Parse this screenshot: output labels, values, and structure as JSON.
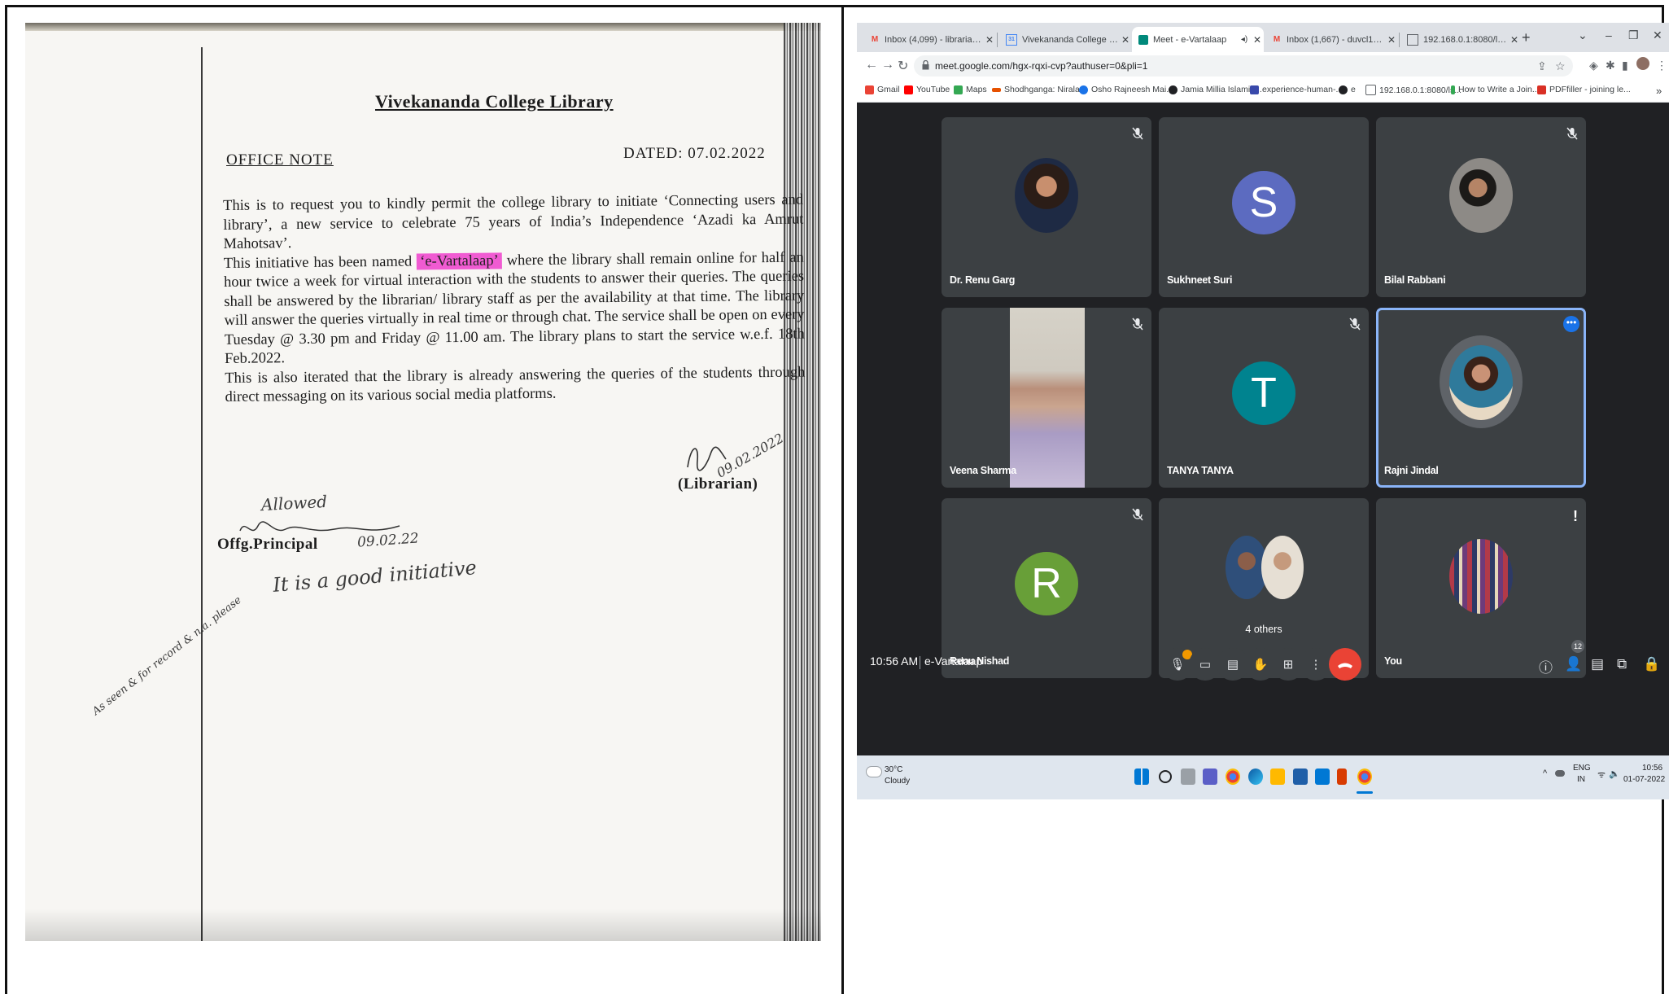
{
  "note": {
    "title": "Vivekananda College Library",
    "heading": "OFFICE NOTE",
    "dated": "DATED: 07.02.2022",
    "para1": "This is to request you to kindly permit the college library to initiate ‘Connecting users and library’, a new service to celebrate 75 years of India’s Independence ‘Azadi ka Amrut Mahotsav’.",
    "para2_before": "This initiative has been named",
    "para2_highlight": "‘e-Vartalaap’",
    "para2_after": "where the library shall remain online for half an hour twice a week for virtual interaction with the students to answer their queries. The queries shall be answered by the librarian/ library staff as per the availability at that time. The library will answer the queries virtually in real time or through chat. The service shall be open on every Tuesday @ 3.30 pm and Friday @ 11.00 am. The library plans to start the service w.e.f. 18th Feb.2022.",
    "para3": "This is also iterated that the library is already answering the queries of the students through direct messaging on its various social media platforms.",
    "librarian": "(Librarian)",
    "librarian_sign_date": "09.02.2022",
    "principal": "Offg.Principal",
    "principal_handwritten_allowed": "Allowed",
    "principal_date": "09.02.22",
    "principal_remark": "It is a good initiative",
    "margin_note": "As seen & for record & n.a. please"
  },
  "browser": {
    "tabs": [
      {
        "title": "Inbox (4,099) - librarian@viveka",
        "icon": "gmail-icon",
        "color": "#ea4335"
      },
      {
        "title": "Vivekananda College - Calendar",
        "icon": "calendar-icon",
        "color": "#4285f4"
      },
      {
        "title": "Meet - e-Vartalaap",
        "icon": "meet-icon",
        "color": "#00897b"
      },
      {
        "title": "Inbox (1,667) - duvcl13@gmail",
        "icon": "gmail-icon",
        "color": "#ea4335"
      },
      {
        "title": "192.168.0.1:8080/lsease/logout",
        "icon": "page-icon",
        "color": "#5f6368"
      }
    ],
    "url": "meet.google.com/hgx-rqxi-cvp?authuser=0&pli=1",
    "bookmarks": [
      {
        "label": "Gmail",
        "color": "#ea4335"
      },
      {
        "label": "YouTube",
        "color": "#ff0000"
      },
      {
        "label": "Maps",
        "color": "#34a853"
      },
      {
        "label": "Shodhganga: Nirala...",
        "color": "#e65100"
      },
      {
        "label": "Osho Rajneesh Mai...",
        "color": "#1a73e8"
      },
      {
        "label": "Jamia Millia Islamia...",
        "color": "#202124"
      },
      {
        "label": "experience-human-...",
        "color": "#3949ab"
      },
      {
        "label": "e",
        "color": "#202124"
      },
      {
        "label": "192.168.0.1:8080/ls...",
        "color": "#5f6368"
      },
      {
        "label": "How to Write a Join...",
        "color": "#34a853"
      },
      {
        "label": "PDFfiller - joining le...",
        "color": "#d93025"
      }
    ],
    "participants": [
      {
        "name": "Dr. Renu Garg",
        "kind": "photo",
        "muted": true
      },
      {
        "name": "Sukhneet Suri",
        "kind": "letter",
        "letter": "S",
        "color": "#5c6bc0",
        "muted": false
      },
      {
        "name": "Bilal Rabbani",
        "kind": "photo",
        "muted": true
      },
      {
        "name": "Veena Sharma",
        "kind": "video",
        "muted": true
      },
      {
        "name": "TANYA TANYA",
        "kind": "letter",
        "letter": "T",
        "color": "#00838f",
        "muted": true
      },
      {
        "name": "Rajni Jindal",
        "kind": "photo",
        "muted": false,
        "speaking": true
      },
      {
        "name": "Renu Nishad",
        "kind": "letter",
        "letter": "R",
        "color": "#689f38",
        "muted": true
      },
      {
        "name": "4 others",
        "kind": "group",
        "muted": false
      },
      {
        "name": "You",
        "kind": "photo",
        "muted": false
      }
    ],
    "meeting_time": "10:56 AM",
    "meeting_name": "e-Vartalaap",
    "participant_count": "12",
    "taskbar": {
      "temperature": "30°C",
      "weather": "Cloudy",
      "lang1": "ENG",
      "lang2": "IN",
      "time": "10:56",
      "date": "01-07-2022"
    }
  }
}
